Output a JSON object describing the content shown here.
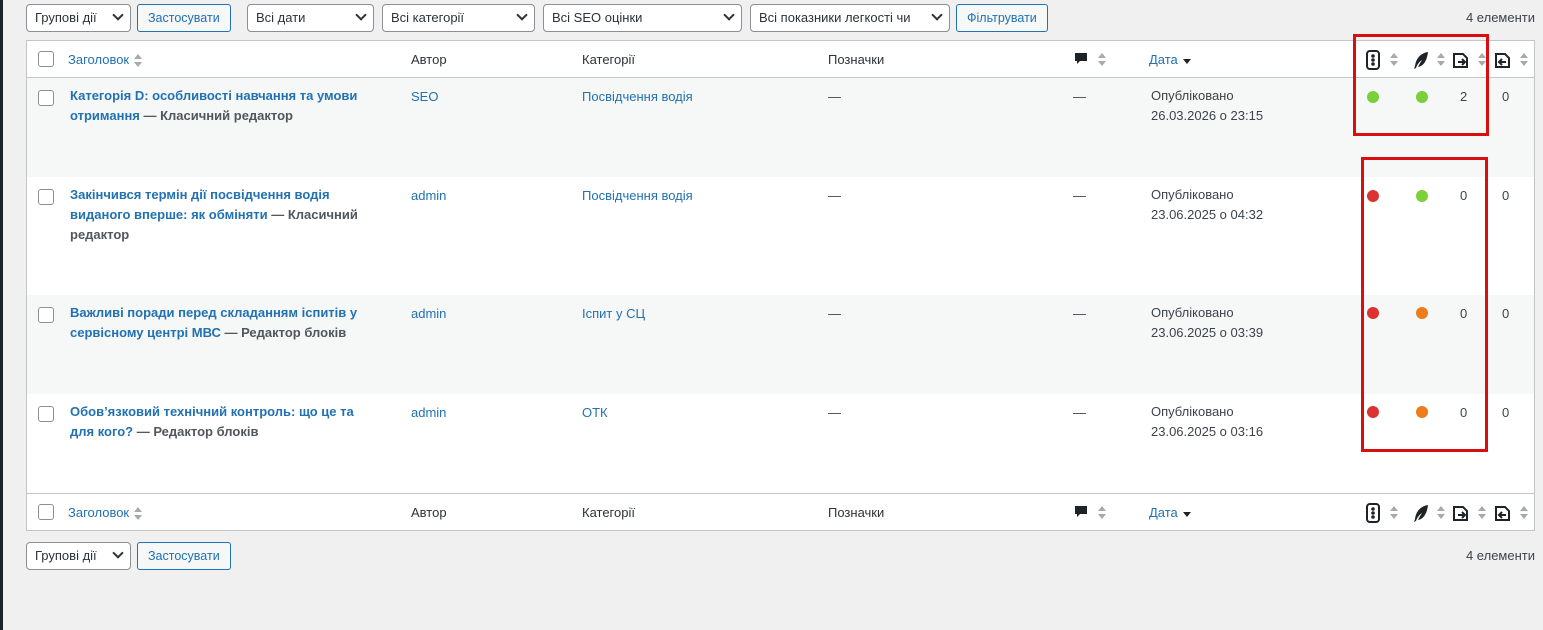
{
  "toolbar_top": {
    "bulk_actions": "Групові дії",
    "apply": "Застосувати",
    "dates": "Всі дати",
    "categories": "Всі категорії",
    "seo": "Всі SEO оцінки",
    "readability": "Всі показники легкості чи",
    "filter": "Фільтрувати",
    "count": "4 елементи"
  },
  "toolbar_bottom": {
    "bulk_actions": "Групові дії",
    "apply": "Застосувати",
    "count": "4 елементи"
  },
  "columns": {
    "title": "Заголовок",
    "author": "Автор",
    "categories": "Категорії",
    "tags": "Позначки",
    "date": "Дата"
  },
  "colors": {
    "green": "#7ad03a",
    "red": "#dc3232",
    "orange": "#ee7c1b",
    "link": "#2271b1",
    "highlight": "#d90e0e"
  },
  "icons": [
    "comments-icon",
    "seo-traffic-light-icon",
    "readability-feather-icon",
    "internal-links-out-icon",
    "internal-links-in-icon"
  ],
  "rows": [
    {
      "title": "Категорія D: особливості навчання та умови отримання",
      "editor": " — Класичний редактор",
      "author": "SEO",
      "category": "Посвідчення водія",
      "tags": "—",
      "comments": "—",
      "status": "Опубліковано",
      "date": "26.03.2026 о 23:15",
      "seo": "green",
      "readability": "green",
      "links_out": "2",
      "links_in": "0"
    },
    {
      "title": "Закінчився термін дії посвідчення водія виданого вперше: як обміняти",
      "editor": " — Класичний редактор",
      "author": "admin",
      "category": "Посвідчення водія",
      "tags": "—",
      "comments": "—",
      "status": "Опубліковано",
      "date": "23.06.2025 о 04:32",
      "seo": "red",
      "readability": "green",
      "links_out": "0",
      "links_in": "0"
    },
    {
      "title": "Важливі поради перед складанням іспитів у сервісному центрі МВС",
      "editor": " — Редактор блоків",
      "author": "admin",
      "category": "Іспит у СЦ",
      "tags": "—",
      "comments": "—",
      "status": "Опубліковано",
      "date": "23.06.2025 о 03:39",
      "seo": "red",
      "readability": "orange",
      "links_out": "0",
      "links_in": "0"
    },
    {
      "title": "Обов’язковий технічний контроль: що це та для кого?",
      "editor": " — Редактор блоків",
      "author": "admin",
      "category": "ОТК",
      "tags": "—",
      "comments": "—",
      "status": "Опубліковано",
      "date": "23.06.2025 о 03:16",
      "seo": "red",
      "readability": "orange",
      "links_out": "0",
      "links_in": "0"
    }
  ]
}
